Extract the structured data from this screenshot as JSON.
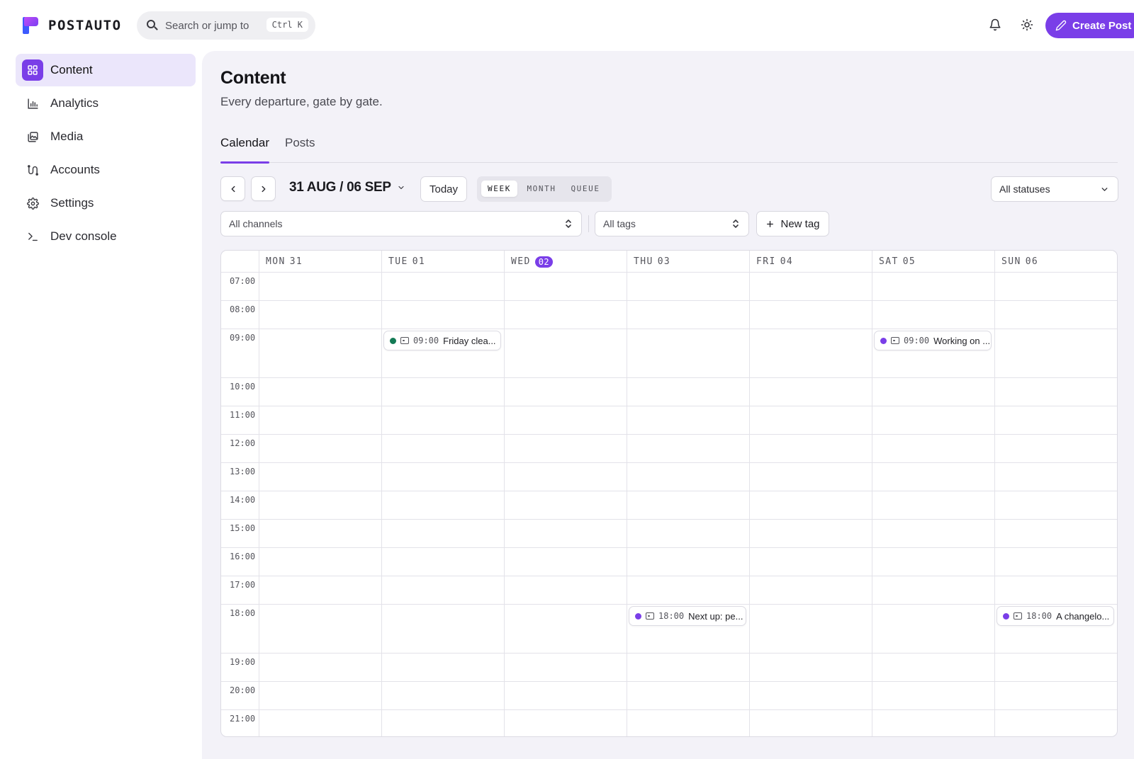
{
  "app": {
    "brand": "POSTAUTO",
    "search_placeholder": "Search or jump to",
    "search_shortcut": "Ctrl K",
    "create_button": "Create Post",
    "accent": "#7a3ee8"
  },
  "sidebar": {
    "items": [
      {
        "label": "Content",
        "icon": "grid-icon",
        "active": true
      },
      {
        "label": "Analytics",
        "icon": "bar-chart-icon",
        "active": false
      },
      {
        "label": "Media",
        "icon": "media-icon",
        "active": false
      },
      {
        "label": "Accounts",
        "icon": "accounts-icon",
        "active": false
      },
      {
        "label": "Settings",
        "icon": "gear-icon",
        "active": false
      },
      {
        "label": "Dev console",
        "icon": "terminal-icon",
        "active": false
      }
    ]
  },
  "page": {
    "title": "Content",
    "subtitle": "Every departure, gate by gate.",
    "tabs": [
      {
        "label": "Calendar",
        "active": true
      },
      {
        "label": "Posts",
        "active": false
      }
    ]
  },
  "toolbar": {
    "date_range": "31 AUG / 06 SEP",
    "today": "Today",
    "views": [
      {
        "label": "WEEK",
        "active": true
      },
      {
        "label": "MONTH",
        "active": false
      },
      {
        "label": "QUEUE",
        "active": false
      }
    ],
    "status_filter": "All statuses",
    "channel_filter": "All channels",
    "tag_filter": "All tags",
    "new_tag": "New tag"
  },
  "calendar": {
    "days": [
      {
        "name": "MON",
        "date": "31",
        "today": false
      },
      {
        "name": "TUE",
        "date": "01",
        "today": false
      },
      {
        "name": "WED",
        "date": "02",
        "today": true
      },
      {
        "name": "THU",
        "date": "03",
        "today": false
      },
      {
        "name": "FRI",
        "date": "04",
        "today": false
      },
      {
        "name": "SAT",
        "date": "05",
        "today": false
      },
      {
        "name": "SUN",
        "date": "06",
        "today": false
      }
    ],
    "hours": [
      "07:00",
      "08:00",
      "09:00",
      "10:00",
      "11:00",
      "12:00",
      "13:00",
      "14:00",
      "15:00",
      "16:00",
      "17:00",
      "18:00",
      "19:00",
      "20:00",
      "21:00"
    ],
    "events": [
      {
        "day": 1,
        "hour": "09:00",
        "time": "09:00",
        "title": "Friday clea...",
        "status_color": "#137a55"
      },
      {
        "day": 5,
        "hour": "09:00",
        "time": "09:00",
        "title": "Working on ...",
        "status_color": "#7a3ee8"
      },
      {
        "day": 3,
        "hour": "18:00",
        "time": "18:00",
        "title": "Next up: pe...",
        "status_color": "#7a3ee8"
      },
      {
        "day": 6,
        "hour": "18:00",
        "time": "18:00",
        "title": "A changelo...",
        "status_color": "#7a3ee8"
      }
    ]
  }
}
